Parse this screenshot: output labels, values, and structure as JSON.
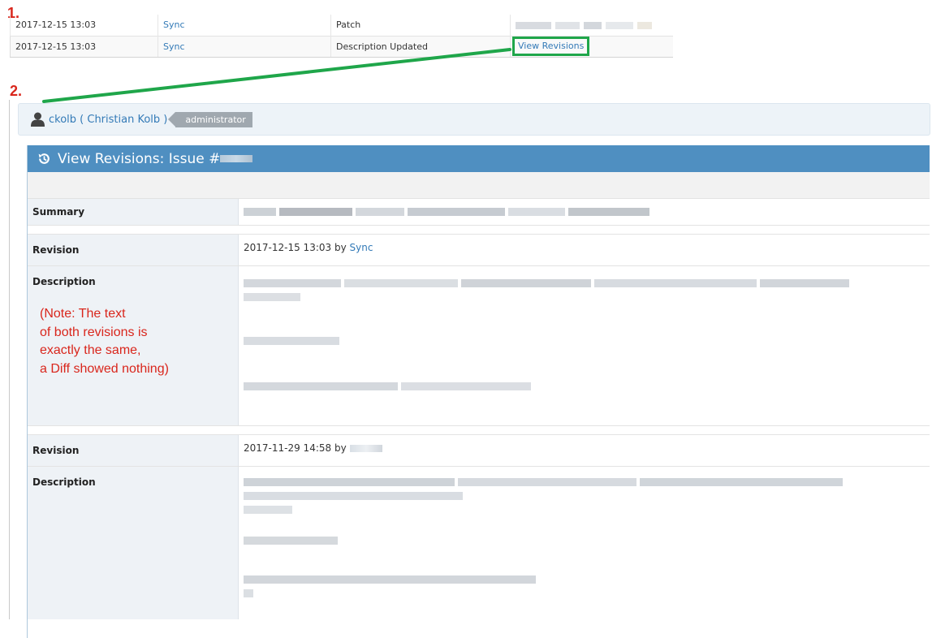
{
  "steps": {
    "one": "1.",
    "two": "2."
  },
  "history": {
    "rows": [
      {
        "date": "2017-12-15 13:03",
        "user": "Sync",
        "field": "Patch",
        "change": ""
      },
      {
        "date": "2017-12-15 13:03",
        "user": "Sync",
        "field": "Description Updated",
        "change": "View Revisions"
      }
    ]
  },
  "userbar": {
    "user": "ckolb ( Christian Kolb )",
    "role": "administrator"
  },
  "widget": {
    "title": "View Revisions: Issue #",
    "summary_label": "Summary",
    "revisions": [
      {
        "revision_label": "Revision",
        "date": "2017-12-15 13:03",
        "by": "by",
        "author": "Sync",
        "description_label": "Description",
        "note": [
          "(Note: The text",
          "of both revisions is",
          "exactly the same,",
          "a Diff showed nothing)"
        ]
      },
      {
        "revision_label": "Revision",
        "date": "2017-11-29 14:58",
        "by": "by",
        "author": "",
        "description_label": "Description"
      }
    ]
  },
  "colors": {
    "header_blue": "#4f8fc1",
    "link_blue": "#337ab7",
    "annotation_red": "#d9261c",
    "annotation_green": "#1fa64a"
  }
}
